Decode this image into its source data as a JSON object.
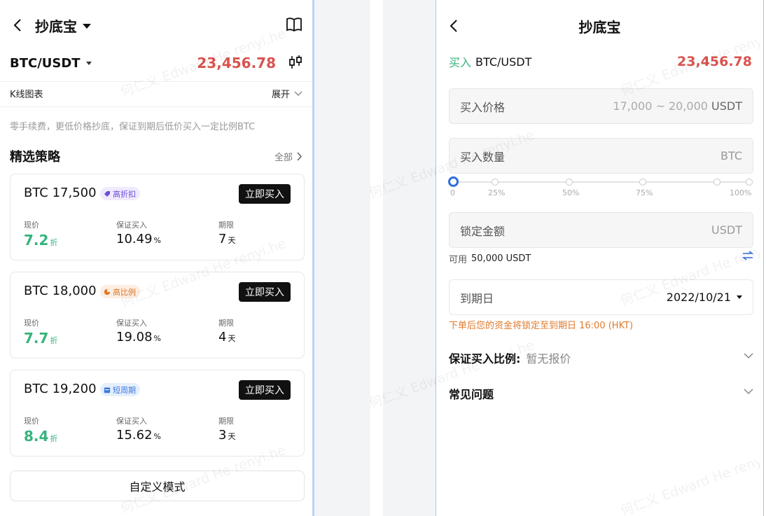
{
  "left": {
    "nav": {
      "title": "抄底宝"
    },
    "pair": {
      "symbol": "BTC/USDT",
      "price": "23,456.78"
    },
    "kline": {
      "label": "K线图表",
      "expand": "展开"
    },
    "description": "零手续费，更低价格抄底，保证到期后低价买入一定比例BTC",
    "section": {
      "title": "精选策略",
      "all": "全部"
    },
    "stat_labels": {
      "current": "现价",
      "guaranteed": "保证买入",
      "term": "期限"
    },
    "cards": [
      {
        "name": "BTC 17,500",
        "tag": "高折扣",
        "button": "立即买入",
        "current": "7.2",
        "current_unit": "折",
        "guaranteed": "10.49",
        "guaranteed_unit": "%",
        "term": "7",
        "term_unit": "天"
      },
      {
        "name": "BTC 18,000",
        "tag": "高比例",
        "button": "立即买入",
        "current": "7.7",
        "current_unit": "折",
        "guaranteed": "19.08",
        "guaranteed_unit": "%",
        "term": "4",
        "term_unit": "天"
      },
      {
        "name": "BTC 19,200",
        "tag": "短周期",
        "button": "立即买入",
        "current": "8.4",
        "current_unit": "折",
        "guaranteed": "15.62",
        "guaranteed_unit": "%",
        "term": "3",
        "term_unit": "天"
      }
    ],
    "custom_button": "自定义模式"
  },
  "right": {
    "nav": {
      "title": "抄底宝"
    },
    "pair": {
      "side": "买入",
      "symbol": "BTC/USDT",
      "price": "23,456.78"
    },
    "price_field": {
      "label": "买入价格",
      "range": "17,000 ~ 20,000",
      "unit": "USDT"
    },
    "qty_field": {
      "label": "买入数量",
      "unit": "BTC"
    },
    "slider": {
      "value_percent": 0,
      "labels": [
        "0",
        "25%",
        "50%",
        "75%",
        "100%"
      ]
    },
    "lock_field": {
      "label": "锁定金额",
      "unit": "USDT"
    },
    "available": {
      "label": "可用",
      "amount": "50,000 USDT"
    },
    "expiry": {
      "label": "到期日",
      "value": "2022/10/21"
    },
    "notice": "下单后您的资金将锁定至到期日 16:00 (HKT)",
    "ratio": {
      "label": "保证买入比例:",
      "value": "暂无报价"
    },
    "faq": {
      "label": "常见问题"
    }
  },
  "watermark": "何仁义 Edward He renyi.he",
  "colors": {
    "price_red": "#d9534f",
    "green": "#37b37e",
    "accent_blue": "#2e6fe0",
    "notice_orange": "#e07a2b"
  }
}
